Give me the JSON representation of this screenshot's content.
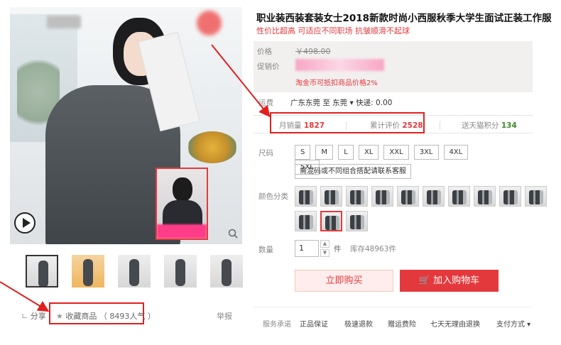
{
  "product": {
    "title": "职业装西装套装女士2018新款时尚小西服秋季大学生面试正装工作服",
    "subtitle": "性价比超高 可适应不同职场 抗皱顺滑不起球"
  },
  "gallery": {
    "thumb_count": 5,
    "share_label": "分享",
    "favorite_label": "收藏商品",
    "favorite_popularity": "（ 8493人气 ）",
    "report_label": "举报"
  },
  "price": {
    "price_label": "价格",
    "original_price": "￥498.00",
    "promo_label": "促销价",
    "coin_note": "淘金币可抵扣商品价格2%"
  },
  "shipping": {
    "label": "运费",
    "value": "广东东莞 至 东莞 ▾ 快递: 0.00"
  },
  "stats": {
    "monthly_sales_label": "月销量",
    "monthly_sales_value": "1827",
    "reviews_label": "累计评价",
    "reviews_value": "2528",
    "tmall_points_label": "送天猫积分",
    "tmall_points_value": "134"
  },
  "options": {
    "size_label": "尺码",
    "sizes": [
      "S",
      "M",
      "L",
      "XL",
      "XXL",
      "3XL",
      "4XL",
      "5XL"
    ],
    "size_note": "需混码或不同组合搭配请联系客服",
    "color_label": "颜色分类",
    "color_swatch_count": 13,
    "selected_color_index": 11,
    "quantity_label": "数量",
    "quantity_value": "1",
    "unit": "件",
    "stock": "库存48963件"
  },
  "actions": {
    "buy_now": "立即购买",
    "add_to_cart": "加入购物车"
  },
  "service": {
    "label": "服务承诺",
    "items": [
      "正品保证",
      "极速退款",
      "赠运费险",
      "七天无理由退换"
    ],
    "payment_label": "支付方式 ▾"
  },
  "colors": {
    "accent": "#e4393c",
    "annotation": "#e02020",
    "tmall_points": "#3a8a2a"
  }
}
